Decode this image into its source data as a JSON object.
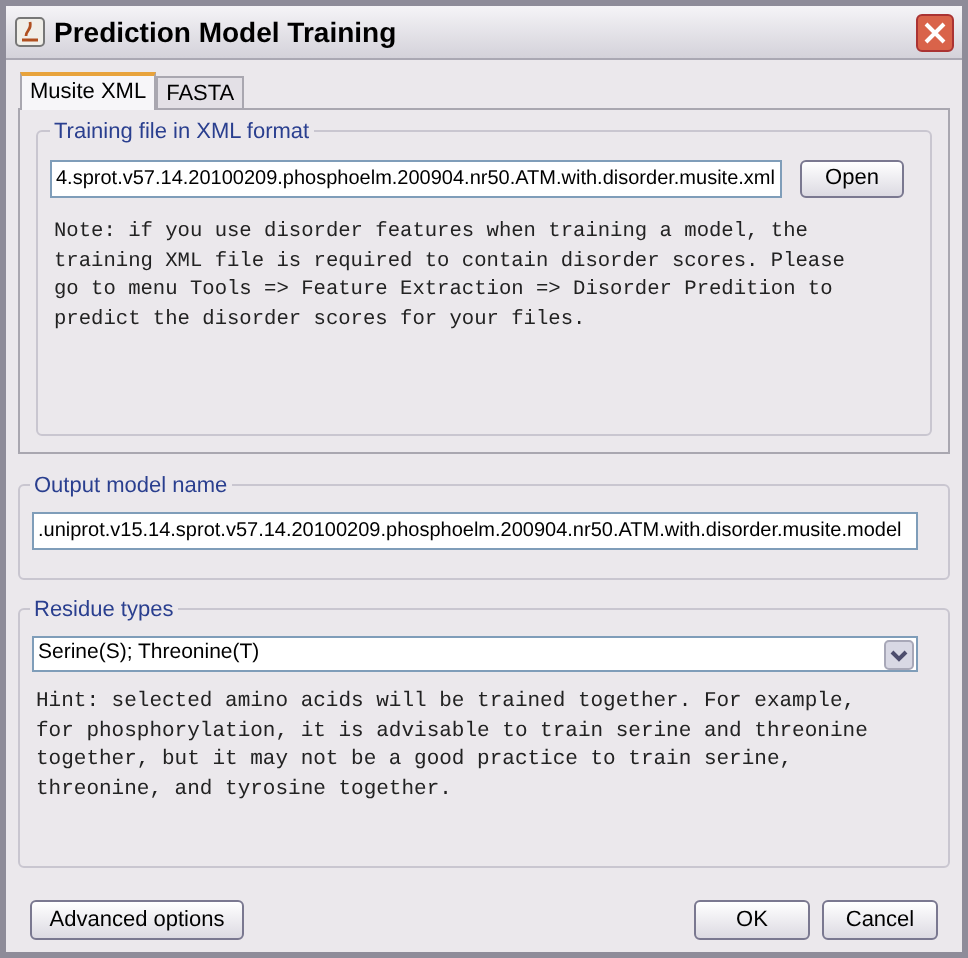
{
  "window": {
    "title": "Prediction Model Training"
  },
  "tabs": [
    {
      "label": "Musite XML",
      "selected": true
    },
    {
      "label": "FASTA",
      "selected": false
    }
  ],
  "training_file": {
    "legend": "Training file in XML format",
    "value": "4.sprot.v57.14.20100209.phosphoelm.200904.nr50.ATM.with.disorder.musite.xml",
    "button": "Open",
    "note": "Note: if you use disorder features when training a model, the training XML file is required to contain disorder scores. Please go to menu Tools => Feature Extraction => Disorder Predition to predict the disorder scores for your files."
  },
  "output_model": {
    "legend": "Output model name",
    "value": ".uniprot.v15.14.sprot.v57.14.20100209.phosphoelm.200904.nr50.ATM.with.disorder.musite.model"
  },
  "residue_types": {
    "legend": "Residue types",
    "value": "Serine(S); Threonine(T)",
    "hint": "Hint: selected amino acids will be trained together. For example, for phosphorylation, it is advisable to train serine and threonine together, but it may not be a good practice to train serine, threonine, and tyrosine together."
  },
  "buttons": {
    "advanced": "Advanced options",
    "ok": "OK",
    "cancel": "Cancel"
  }
}
